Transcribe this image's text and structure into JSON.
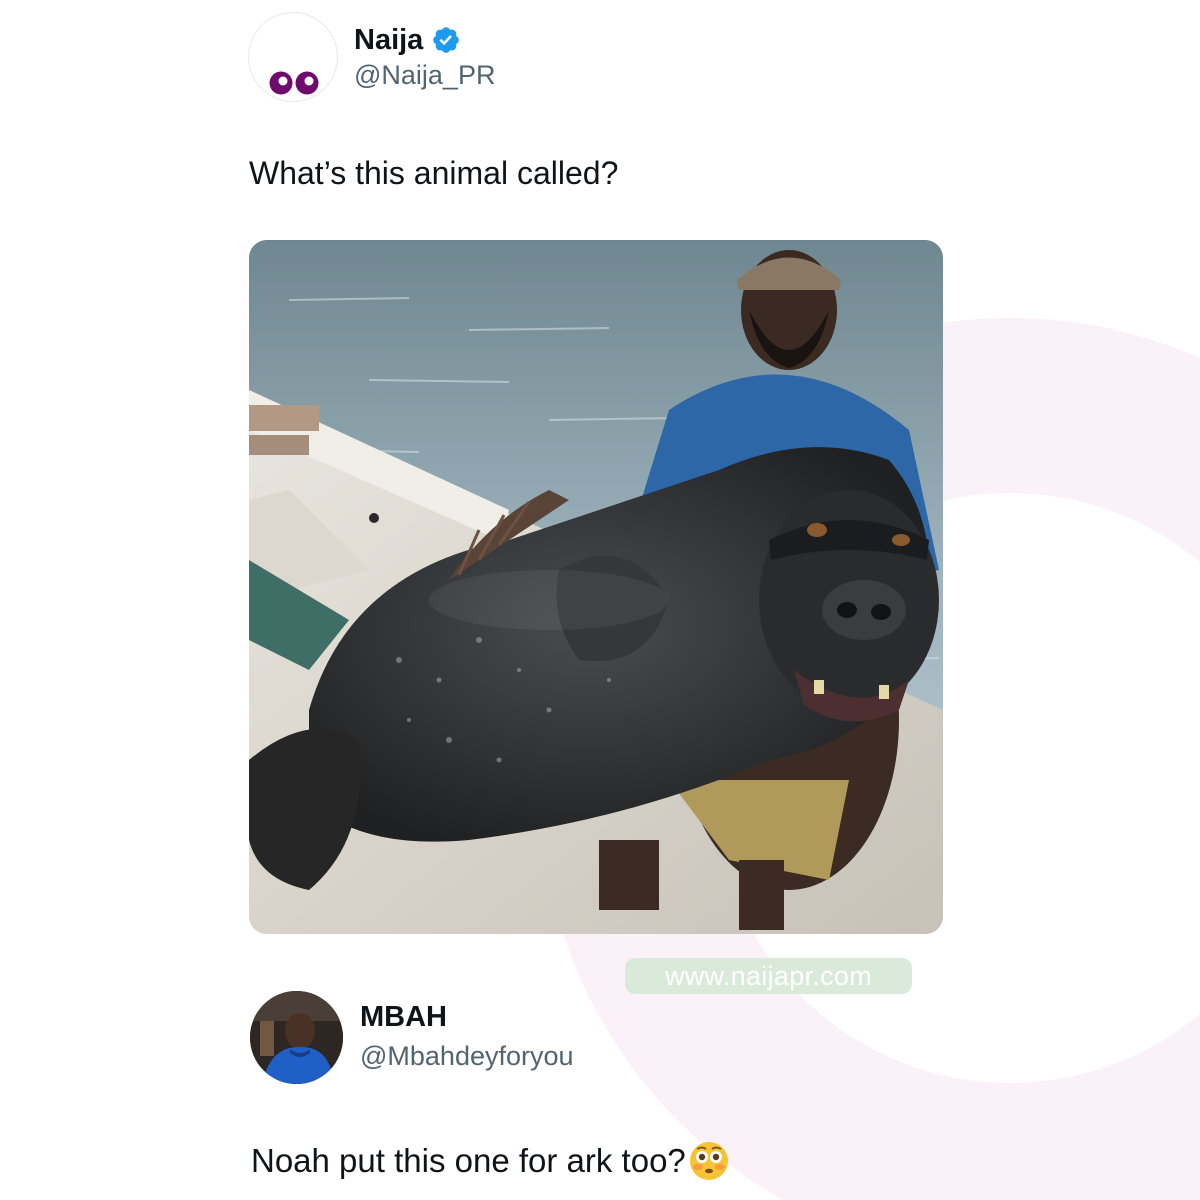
{
  "post": {
    "author": {
      "display_name": "Naija",
      "handle": "@Naija_PR",
      "verified": true,
      "avatar_icon": "purple-eyes-logo-icon"
    },
    "text": "What’s this animal called?",
    "media": {
      "type": "photo",
      "icon": "fish-gorilla-photo"
    }
  },
  "watermark": {
    "text": "www.naijapr.com"
  },
  "reply": {
    "author": {
      "display_name": "MBAH",
      "handle": "@Mbahdeyforyou",
      "avatar_icon": "user-avatar-photo"
    },
    "text": "Noah put this one for ark too?",
    "emoji": "flushed-face-icon"
  },
  "colors": {
    "text_primary": "#0f1419",
    "text_secondary": "#536471",
    "verified_blue": "#1d9bf0",
    "logo_purple": "#6f0a6e",
    "watermark_bg": "#d9eadb",
    "background_ring": "#fbf1f9"
  }
}
